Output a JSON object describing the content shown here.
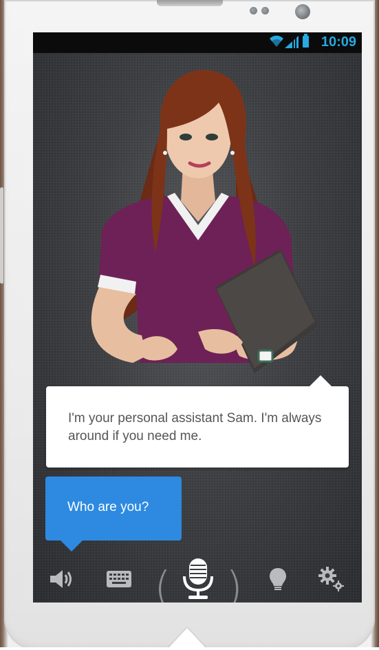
{
  "status_bar": {
    "time": "10:09",
    "wifi_icon": "wifi-icon",
    "signal_icon": "signal-icon",
    "battery_icon": "battery-icon",
    "accent_color": "#27a9e1"
  },
  "assistant": {
    "avatar_icon": "assistant-avatar",
    "message": "I'm your personal assistant Sam. I'm always around if you need me."
  },
  "user": {
    "message": "Who are you?",
    "bubble_color": "#2d8ae0"
  },
  "toolbar": {
    "items": [
      {
        "name": "speaker-icon"
      },
      {
        "name": "keyboard-icon"
      },
      {
        "name": "microphone-icon"
      },
      {
        "name": "lightbulb-icon"
      },
      {
        "name": "settings-gears-icon"
      }
    ]
  }
}
